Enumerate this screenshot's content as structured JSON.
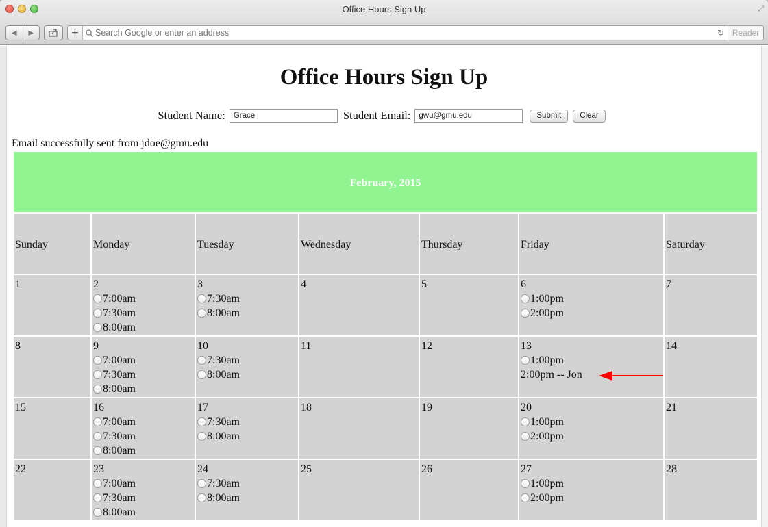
{
  "window": {
    "title": "Office Hours Sign Up",
    "address_placeholder": "Search Google or enter an address",
    "reader_label": "Reader"
  },
  "page": {
    "heading": "Office Hours Sign Up",
    "form": {
      "name_label": "Student Name:",
      "name_value": "Grace",
      "email_label": "Student Email:",
      "email_value": "gwu@gmu.edu",
      "submit_label": "Submit",
      "clear_label": "Clear"
    },
    "status_message": "Email successfully sent from jdoe@gmu.edu",
    "calendar": {
      "month": "February, 2015",
      "day_names": [
        "Sunday",
        "Monday",
        "Tuesday",
        "Wednesday",
        "Thursday",
        "Friday",
        "Saturday"
      ],
      "weeks": [
        [
          {
            "date": "1",
            "slots": []
          },
          {
            "date": "2",
            "slots": [
              "7:00am",
              "7:30am",
              "8:00am"
            ]
          },
          {
            "date": "3",
            "slots": [
              "7:30am",
              "8:00am"
            ]
          },
          {
            "date": "4",
            "slots": []
          },
          {
            "date": "5",
            "slots": []
          },
          {
            "date": "6",
            "slots": [
              "1:00pm",
              "2:00pm"
            ]
          },
          {
            "date": "7",
            "slots": []
          }
        ],
        [
          {
            "date": "8",
            "slots": []
          },
          {
            "date": "9",
            "slots": [
              "7:00am",
              "7:30am",
              "8:00am"
            ]
          },
          {
            "date": "10",
            "slots": [
              "7:30am",
              "8:00am"
            ]
          },
          {
            "date": "11",
            "slots": []
          },
          {
            "date": "12",
            "slots": []
          },
          {
            "date": "13",
            "slots": [
              "1:00pm"
            ],
            "booked": "2:00pm -- Jon"
          },
          {
            "date": "14",
            "slots": []
          }
        ],
        [
          {
            "date": "15",
            "slots": []
          },
          {
            "date": "16",
            "slots": [
              "7:00am",
              "7:30am",
              "8:00am"
            ]
          },
          {
            "date": "17",
            "slots": [
              "7:30am",
              "8:00am"
            ]
          },
          {
            "date": "18",
            "slots": []
          },
          {
            "date": "19",
            "slots": []
          },
          {
            "date": "20",
            "slots": [
              "1:00pm",
              "2:00pm"
            ]
          },
          {
            "date": "21",
            "slots": []
          }
        ],
        [
          {
            "date": "22",
            "slots": []
          },
          {
            "date": "23",
            "slots": [
              "7:00am",
              "7:30am",
              "8:00am"
            ]
          },
          {
            "date": "24",
            "slots": [
              "7:30am",
              "8:00am"
            ]
          },
          {
            "date": "25",
            "slots": []
          },
          {
            "date": "26",
            "slots": []
          },
          {
            "date": "27",
            "slots": [
              "1:00pm",
              "2:00pm"
            ]
          },
          {
            "date": "28",
            "slots": []
          }
        ]
      ]
    }
  },
  "colors": {
    "month_header_bg": "#90f590",
    "cell_bg": "#d3d3d3",
    "arrow": "#ff0000"
  }
}
